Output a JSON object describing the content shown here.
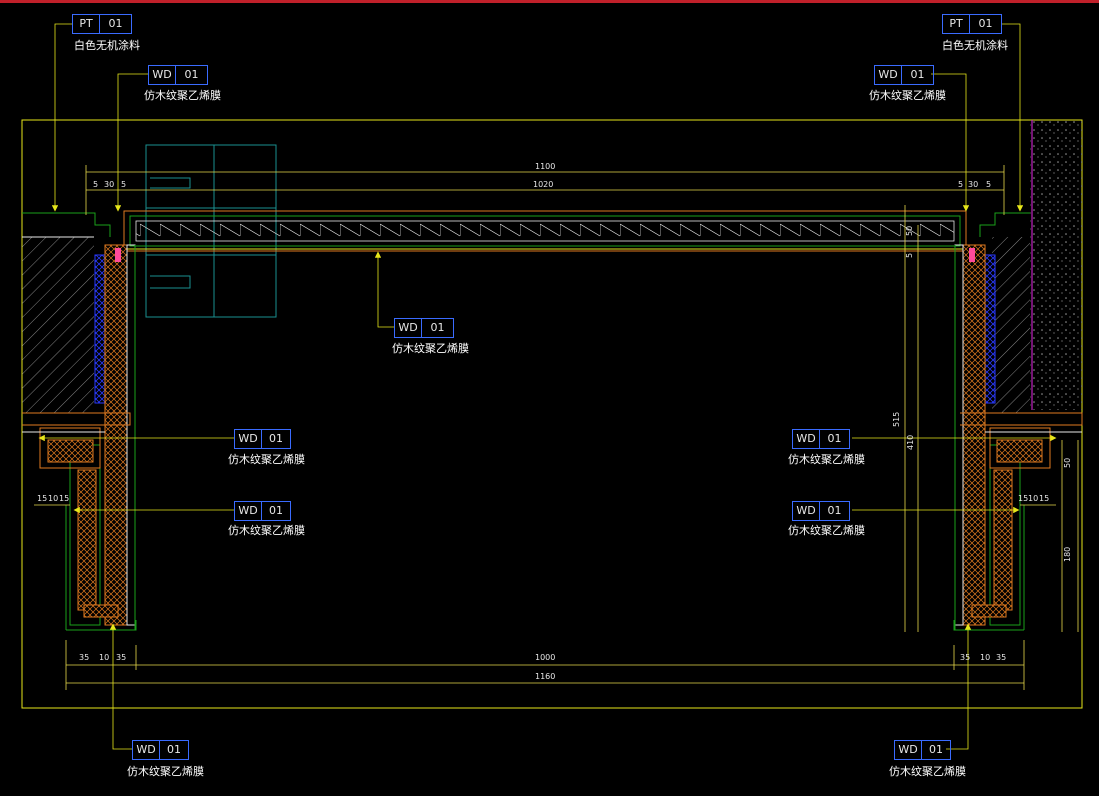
{
  "colors": {
    "background": "#000000",
    "top_border": "#c0202a",
    "frame": "#e6e61a",
    "wood": "#e07a1f",
    "dimension": "#e6d84a",
    "wall": "#1aa01a",
    "glass": "#1a9090",
    "blue_section": "#2a3aff",
    "tag_border": "#3a6bff",
    "pink": "#ff4a9a",
    "magenta": "#c020c0"
  },
  "callouts": [
    {
      "id": "pt-left",
      "code": "PT",
      "num": "01",
      "text": "白色无机涂料"
    },
    {
      "id": "wd-left-top",
      "code": "WD",
      "num": "01",
      "text": "仿木纹聚乙烯膜"
    },
    {
      "id": "pt-right",
      "code": "PT",
      "num": "01",
      "text": "白色无机涂料"
    },
    {
      "id": "wd-right-top",
      "code": "WD",
      "num": "01",
      "text": "仿木纹聚乙烯膜"
    },
    {
      "id": "wd-center",
      "code": "WD",
      "num": "01",
      "text": "仿木纹聚乙烯膜"
    },
    {
      "id": "wd-left-mid1",
      "code": "WD",
      "num": "01",
      "text": "仿木纹聚乙烯膜"
    },
    {
      "id": "wd-left-mid2",
      "code": "WD",
      "num": "01",
      "text": "仿木纹聚乙烯膜"
    },
    {
      "id": "wd-right-mid1",
      "code": "WD",
      "num": "01",
      "text": "仿木纹聚乙烯膜"
    },
    {
      "id": "wd-right-mid2",
      "code": "WD",
      "num": "01",
      "text": "仿木纹聚乙烯膜"
    },
    {
      "id": "wd-left-bottom",
      "code": "WD",
      "num": "01",
      "text": "仿木纹聚乙烯膜"
    },
    {
      "id": "wd-right-bottom",
      "code": "WD",
      "num": "01",
      "text": "仿木纹聚乙烯膜"
    }
  ],
  "dimensions": {
    "top_overall": "1100",
    "top_inner": "1020",
    "top_left_a": "5",
    "top_left_b": "30",
    "top_left_c": "5",
    "top_right_a": "5",
    "top_right_b": "30",
    "top_right_c": "5",
    "bottom_inner": "1000",
    "bottom_overall": "1160",
    "bottom_left_a": "35",
    "bottom_left_b": "10",
    "bottom_left_c": "35",
    "bottom_right_a": "35",
    "bottom_right_b": "10",
    "bottom_right_c": "35",
    "left_small_a": "15",
    "left_small_b": "10",
    "left_small_c": "15",
    "right_small_a": "15",
    "right_small_b": "10",
    "right_small_c": "15",
    "right_v_50": "50",
    "right_v_5": "5",
    "right_v_515": "515",
    "right_v_410": "410",
    "right_v_50b": "50",
    "right_v_180": "180"
  }
}
